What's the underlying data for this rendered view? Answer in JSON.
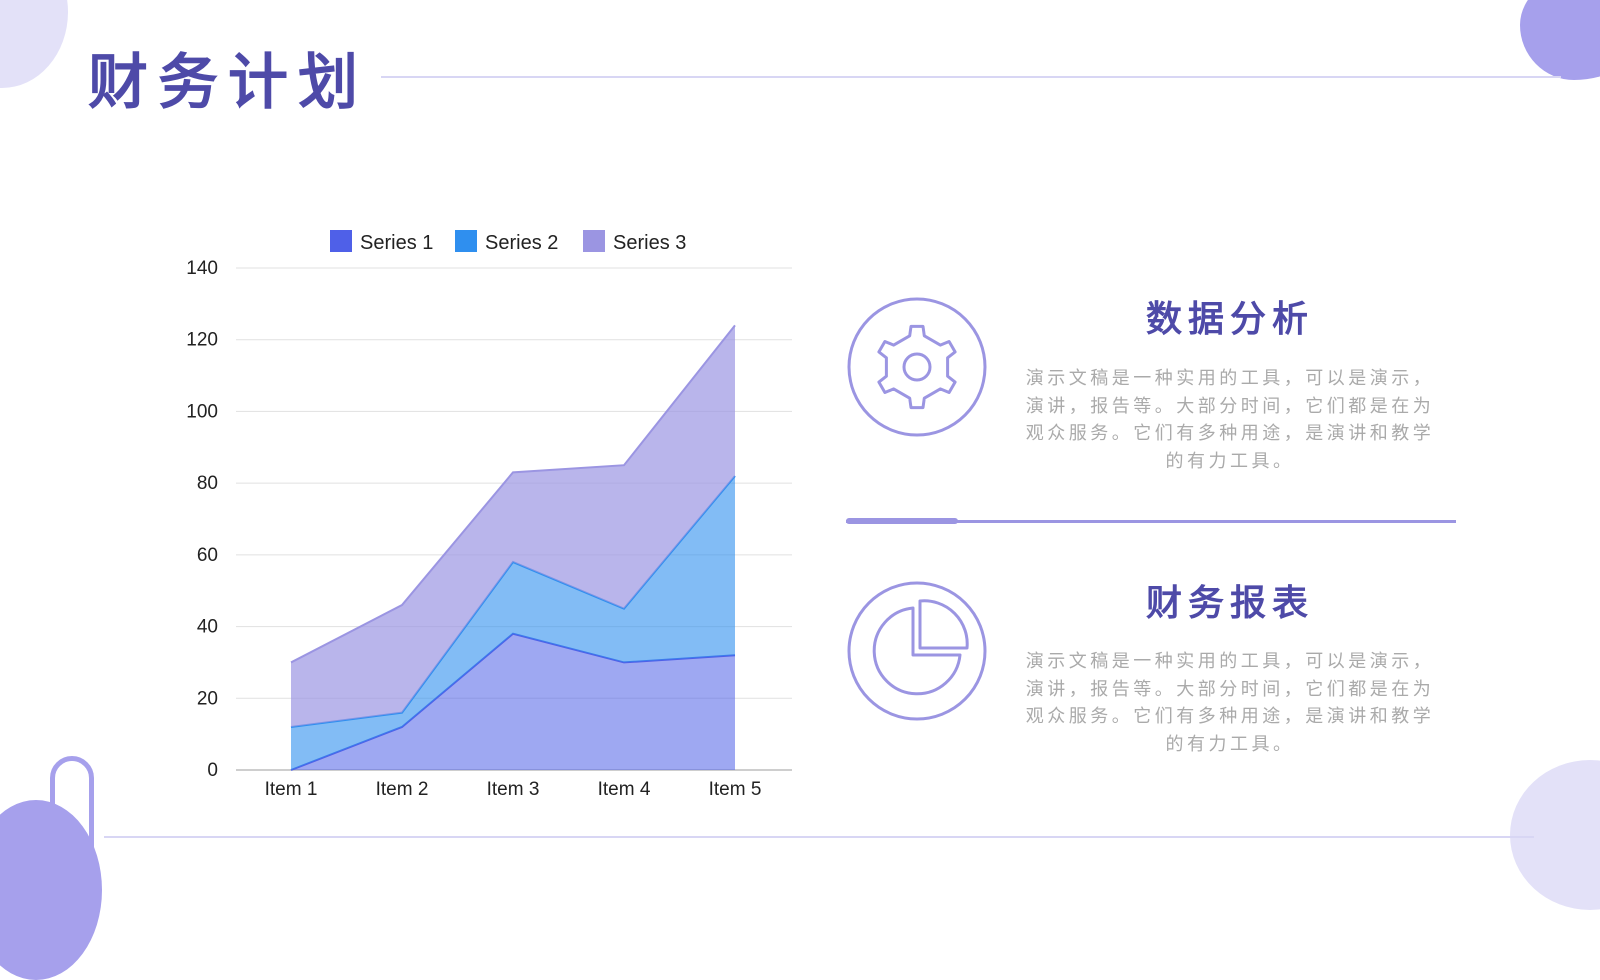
{
  "title": "财务计划",
  "panels": [
    {
      "icon": "gear-icon",
      "title": "数据分析",
      "lines": [
        "演示文稿是一种实用的工具，可以是演示，",
        "演讲，报告等。大部分时间，它们都是在为",
        "观众服务。它们有多种用途，是演讲和教学",
        "的有力工具。"
      ]
    },
    {
      "icon": "pie-chart-icon",
      "title": "财务报表",
      "lines": [
        "演示文稿是一种实用的工具，可以是演示，",
        "演讲，报告等。大部分时间，它们都是在为",
        "观众服务。它们有多种用途，是演讲和教学",
        "的有力工具。"
      ]
    }
  ],
  "colors": {
    "accent": "#4e4aa8",
    "series1": "#4f60e8",
    "series2": "#2f8fef",
    "series3": "#9b95e2"
  },
  "chart_data": {
    "type": "area",
    "stacked": true,
    "categories": [
      "Item 1",
      "Item 2",
      "Item 3",
      "Item 4",
      "Item 5"
    ],
    "series": [
      {
        "name": "Series 1",
        "values": [
          0,
          12,
          38,
          30,
          32
        ]
      },
      {
        "name": "Series 2",
        "values": [
          12,
          4,
          20,
          15,
          50
        ]
      },
      {
        "name": "Series 3",
        "values": [
          18,
          30,
          25,
          40,
          42
        ]
      }
    ],
    "ylim": [
      0,
      140
    ],
    "yticks": [
      0,
      20,
      40,
      60,
      80,
      100,
      120,
      140
    ],
    "grid": true,
    "legend": "top"
  }
}
